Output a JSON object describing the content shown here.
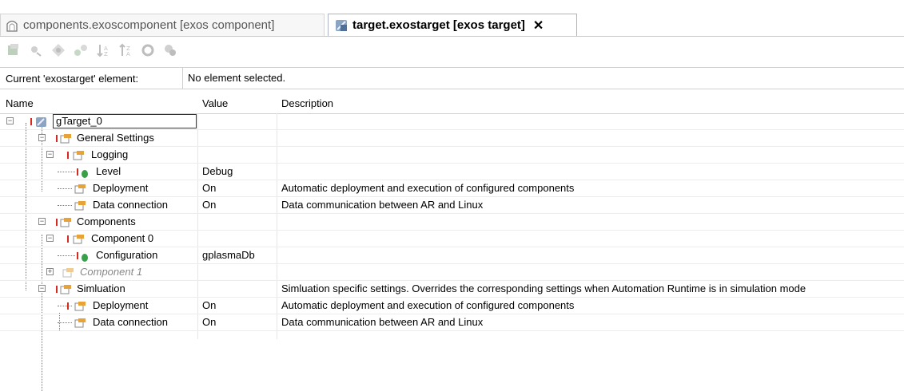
{
  "tabs": [
    {
      "label": "components.exoscomponent [exos component]",
      "active": false,
      "icon": "component-icon"
    },
    {
      "label": "target.exostarget [exos target]",
      "active": true,
      "icon": "target-icon",
      "close": "✕"
    }
  ],
  "toolbar": {
    "icons": [
      "new-element-icon",
      "edit-icon",
      "navigate-icon",
      "connect-icon",
      "sort-ascending-icon",
      "sort-descending-icon",
      "toggle-icon",
      "settings-icon"
    ]
  },
  "current": {
    "label": "Current 'exostarget' element:",
    "value": "No element selected."
  },
  "columns": {
    "name": "Name",
    "value": "Value",
    "description": "Description"
  },
  "rows": [
    {
      "name": "gTarget_0",
      "value": "",
      "description": ""
    },
    {
      "name": "General Settings",
      "value": "",
      "description": ""
    },
    {
      "name": "Logging",
      "value": "",
      "description": ""
    },
    {
      "name": "Level",
      "value": "Debug",
      "description": ""
    },
    {
      "name": "Deployment",
      "value": "On",
      "description": "Automatic deployment and execution of configured components"
    },
    {
      "name": "Data connection",
      "value": "On",
      "description": "Data communication between AR and Linux"
    },
    {
      "name": "Components",
      "value": "",
      "description": ""
    },
    {
      "name": "Component 0",
      "value": "",
      "description": ""
    },
    {
      "name": "Configuration",
      "value": "gplasmaDb",
      "description": ""
    },
    {
      "name": "Component 1",
      "value": "",
      "description": ""
    },
    {
      "name": "Simluation",
      "value": "",
      "description": "Simluation specific settings. Overrides the corresponding settings when Automation Runtime is in simulation mode"
    },
    {
      "name": "Deployment",
      "value": "On",
      "description": "Automatic deployment and execution of configured components"
    },
    {
      "name": "Data connection",
      "value": "On",
      "description": "Data communication between AR and Linux"
    }
  ],
  "colors": {
    "accent": "#d52a1d",
    "leaf": "#39a04a",
    "border": "#cfcfcf"
  }
}
